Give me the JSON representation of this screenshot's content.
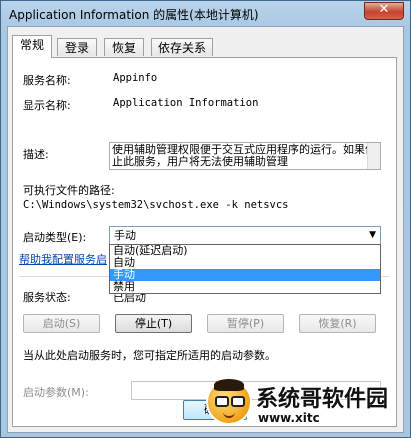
{
  "window": {
    "title": "Application Information 的属性(本地计算机)",
    "close_glyph": "✕"
  },
  "tabs": [
    {
      "label": "常规",
      "active": true
    },
    {
      "label": "登录",
      "active": false
    },
    {
      "label": "恢复",
      "active": false
    },
    {
      "label": "依存关系",
      "active": false
    }
  ],
  "general": {
    "service_name_label": "服务名称:",
    "service_name_value": "Appinfo",
    "display_name_label": "显示名称:",
    "display_name_value": "Application Information",
    "description_label": "描述:",
    "description_value": "使用辅助管理权限便于交互式应用程序的运行。如果停止此服务，用户将无法使用辅助管理",
    "exe_path_label": "可执行文件的路径:",
    "exe_path_value": "C:\\Windows\\system32\\svchost.exe -k netsvcs",
    "startup_type_label": "启动类型(E):",
    "startup_type_value": "手动",
    "startup_options": [
      {
        "label": "自动(延迟启动)",
        "selected": false
      },
      {
        "label": "自动",
        "selected": false
      },
      {
        "label": "手动",
        "selected": true
      },
      {
        "label": "禁用",
        "selected": false
      }
    ],
    "help_link": "帮助我配置服务启",
    "status_label": "服务状态:",
    "status_value": "已启动",
    "buttons": {
      "start": "启动(S)",
      "stop": "停止(T)",
      "pause": "暂停(P)",
      "resume": "恢复(R)"
    },
    "start_params_hint": "当从此处启动服务时，您可指定所适用的启动参数。",
    "start_params_label": "启动参数(M):",
    "ok_button": "确定"
  },
  "watermark": {
    "title": "系统哥软件园",
    "url": "www.xitc"
  }
}
